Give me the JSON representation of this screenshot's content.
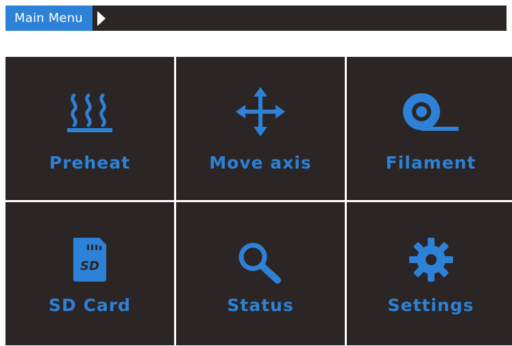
{
  "header": {
    "title": "Main Menu"
  },
  "menu": [
    {
      "label": "Preheat",
      "icon": "heat-icon"
    },
    {
      "label": "Move axis",
      "icon": "move-arrows-icon"
    },
    {
      "label": "Filament",
      "icon": "filament-spool-icon"
    },
    {
      "label": "SD Card",
      "icon": "sd-card-icon"
    },
    {
      "label": "Status",
      "icon": "magnifier-icon"
    },
    {
      "label": "Settings",
      "icon": "gear-icon"
    }
  ],
  "colors": {
    "accent": "#2d81d6",
    "tile": "#2b2525",
    "background": "#ffffff",
    "title_text": "#ffffff"
  }
}
